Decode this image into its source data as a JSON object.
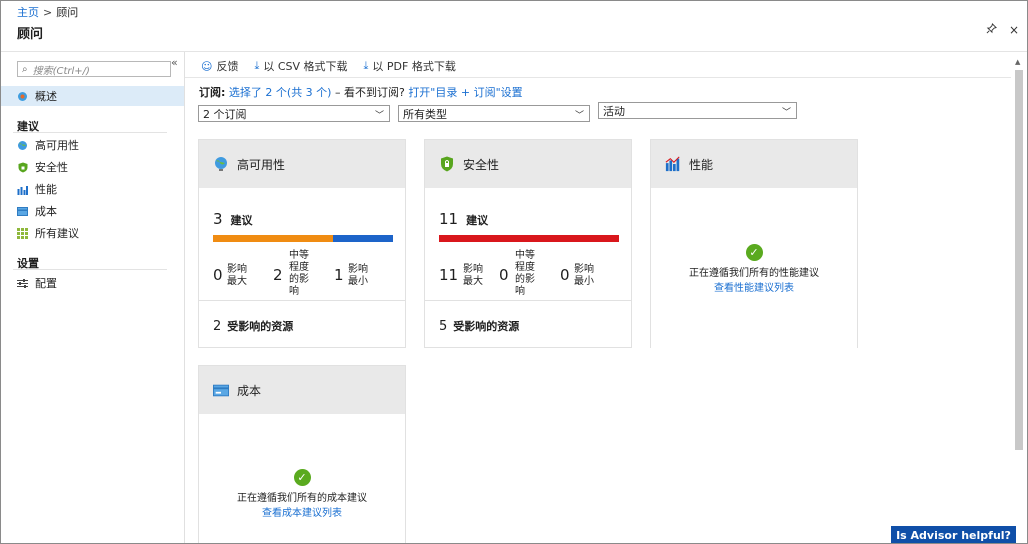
{
  "breadcrumb": {
    "home": "主页",
    "separator": ">",
    "current": "顾问"
  },
  "title": "顾问",
  "top_actions": {
    "pin": "⚲",
    "close": "×"
  },
  "sidebar": {
    "search_placeholder": "搜索(Ctrl+/)",
    "collapse": "«",
    "overview": "概述",
    "section_recommendations": "建议",
    "items": [
      {
        "label": "高可用性",
        "icon": "globe-icon"
      },
      {
        "label": "安全性",
        "icon": "shield-icon"
      },
      {
        "label": "性能",
        "icon": "bar-chart-icon"
      },
      {
        "label": "成本",
        "icon": "card-icon"
      },
      {
        "label": "所有建议",
        "icon": "grid-icon"
      }
    ],
    "section_settings": "设置",
    "config": "配置"
  },
  "toolbar": {
    "feedback": "反馈",
    "csv": "以 CSV 格式下载",
    "pdf": "以 PDF 格式下载"
  },
  "subscription_line": {
    "label": "订阅:",
    "link1": "选择了 2 个(共 3 个)",
    "middle": " – 看不到订阅? ",
    "link2": "打开\"目录 + 订阅\"设置"
  },
  "filters": {
    "subscriptions": "2 个订阅",
    "types": "所有类型",
    "status": "活动"
  },
  "cards": {
    "availability": {
      "title": "高可用性",
      "count": "3",
      "count_label": "建议",
      "high": "0",
      "high_label": "影响最大",
      "medium": "2",
      "medium_label": "中等程度的影响",
      "low": "1",
      "low_label": "影响最小",
      "resources": "2",
      "resources_label": "受影响的资源",
      "bar": {
        "segments": [
          {
            "fraction": 0.667,
            "color": "#f08c12"
          },
          {
            "fraction": 0.333,
            "color": "#1d64c9"
          }
        ]
      }
    },
    "security": {
      "title": "安全性",
      "count": "11",
      "count_label": "建议",
      "high": "11",
      "high_label": "影响最大",
      "medium": "0",
      "medium_label": "中等程度的影响",
      "low": "0",
      "low_label": "影响最小",
      "resources": "5",
      "resources_label": "受影响的资源",
      "bar": {
        "segments": [
          {
            "fraction": 1.0,
            "color": "#d9171c"
          }
        ]
      }
    },
    "performance": {
      "title": "性能",
      "ok_text": "正在遵循我们所有的性能建议",
      "ok_link": "查看性能建议列表"
    },
    "cost": {
      "title": "成本",
      "ok_text": "正在遵循我们所有的成本建议",
      "ok_link": "查看成本建议列表"
    }
  },
  "helpful_button": "Is Advisor helpful?"
}
